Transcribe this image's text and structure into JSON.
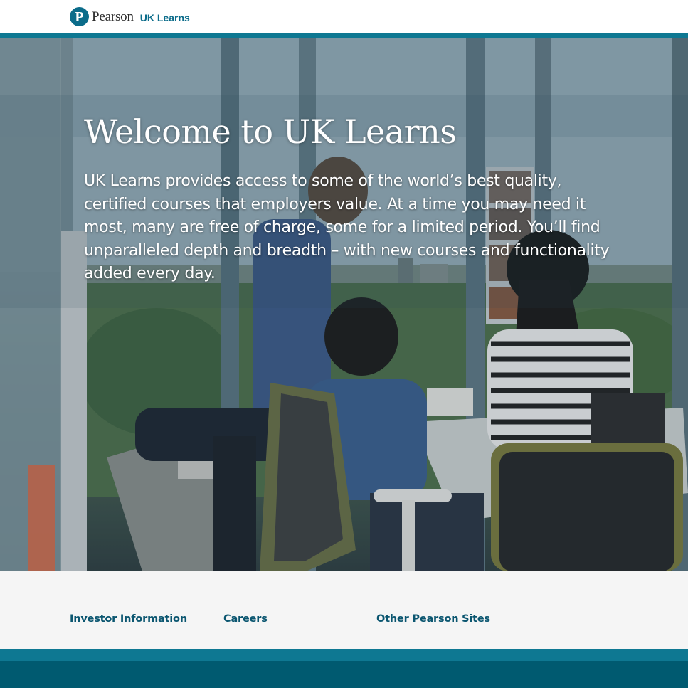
{
  "header": {
    "brand": "Pearson",
    "brand_mark": "P",
    "product": "UK Learns"
  },
  "hero": {
    "title": "Welcome to UK Learns",
    "body": "UK Learns provides access to some of the world’s best quality, certified courses that employers value. At a time you may need it most, many are free of charge, some for a limited period. You’ll find unparalleled depth and breadth – with new courses and functionality added every day."
  },
  "footer": {
    "links": [
      {
        "label": "Investor Information"
      },
      {
        "label": "Careers"
      },
      {
        "label": "Other Pearson Sites"
      }
    ]
  },
  "colors": {
    "brand_teal": "#0e7892",
    "dark_teal": "#005a70",
    "link": "#0b5670",
    "footer_bg": "#f5f5f5"
  }
}
